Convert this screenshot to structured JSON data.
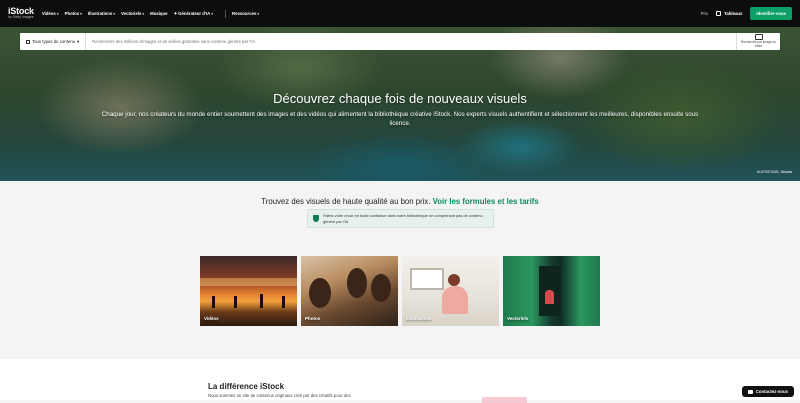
{
  "nav": {
    "logo": "iStock",
    "logo_sub": "by Getty Images",
    "items": [
      {
        "label": "Vidéos",
        "icon": "chevron-down-icon"
      },
      {
        "label": "Photos",
        "icon": "chevron-down-icon"
      },
      {
        "label": "Illustrations",
        "icon": "chevron-down-icon"
      },
      {
        "label": "Vectoriels",
        "icon": "chevron-down-icon"
      },
      {
        "label": "Musique",
        "icon": ""
      },
      {
        "label": "Générateur d'IA",
        "icon": "chevron-down-icon"
      },
      {
        "label": "Ressources",
        "icon": "chevron-down-icon"
      }
    ],
    "pricing": "Prix",
    "boards": "Tableaux",
    "signin": "Identifier-vous"
  },
  "search": {
    "type_label": "Tous types de contenu",
    "placeholder": "Rechercher des millions d'images et de vidéos garanties sans contenu généré par l'IA",
    "image_search_label": "Recherche par image ou vidéo"
  },
  "hero": {
    "title": "Découvrez chaque fois de nouveaux visuels",
    "subtitle": "Chaque jour, nos créateurs du monde entier soumettent des images et des vidéos qui alimentent la bibliothèque créative iStock. Nos experts visuels authentifient et sélectionnent les meilleures, disponibles ensuite sous licence.",
    "credit": "#1470373181, Nikada"
  },
  "pricing": {
    "text": "Trouvez des visuels de haute qualité au bon prix.",
    "link": "Voir les formules et les tarifs",
    "notice": "Faites votre choix en toute confiance dans notre bibliothèque ne comprenant pas de contenu généré par l'IA"
  },
  "tiles": [
    {
      "label": "Vidéos"
    },
    {
      "label": "Photos"
    },
    {
      "label": "Illustrations"
    },
    {
      "label": "Vectoriels"
    }
  ],
  "difference": {
    "title": "La différence iStock",
    "text": "Nous sommes un site de contenus originaux créé par des créatifs pour des"
  },
  "chat": {
    "label": "Contactez-nous"
  },
  "colors": {
    "nav_bg": "#0c0d0d",
    "accent": "#0c9f67",
    "link": "#0b8a5b"
  }
}
